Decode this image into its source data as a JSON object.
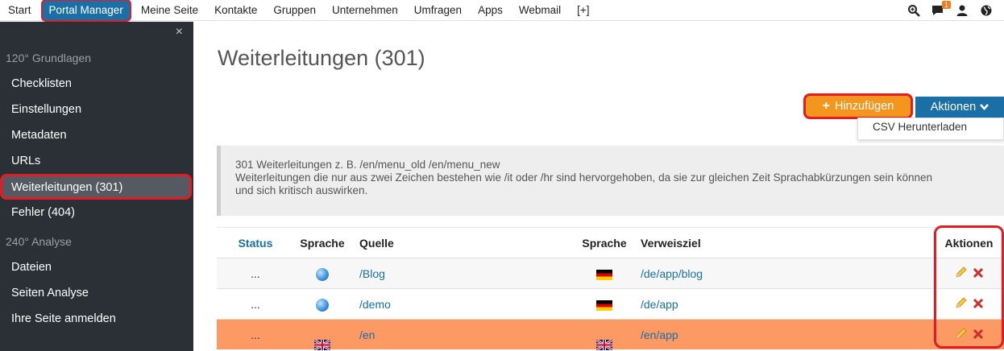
{
  "nav": {
    "items": [
      "Start",
      "Portal Manager",
      "Meine Seite",
      "Kontakte",
      "Gruppen",
      "Unternehmen",
      "Umfragen",
      "Apps",
      "Webmail",
      "[+]"
    ],
    "notification_count": "1"
  },
  "sidebar": {
    "close": "×",
    "section1": "120° Grundlagen",
    "items1": [
      "Checklisten",
      "Einstellungen",
      "Metadaten",
      "URLs",
      "Weiterleitungen (301)",
      "Fehler (404)"
    ],
    "section2": "240° Analyse",
    "items2": [
      "Dateien",
      "Seiten Analyse",
      "Ihre Seite anmelden"
    ]
  },
  "main": {
    "title": "Weiterleitungen (301)",
    "add_button": "Hinzufügen",
    "actions_button": "Aktionen",
    "dropdown_item": "CSV Herunterladen",
    "info_line1": "301 Weiterleitungen z. B. /en/menu_old /en/menu_new",
    "info_line2": "Weiterleitungen die nur aus zwei Zeichen bestehen wie /it oder /hr sind hervorgehoben, da sie zur gleichen Zeit Sprachabkürzungen sein können",
    "info_line3": "und sich kritisch auswirken."
  },
  "table": {
    "headers": {
      "status": "Status",
      "lang1": "Sprache",
      "source": "Quelle",
      "lang2": "Sprache",
      "target": "Verweisziel",
      "actions": "Aktionen"
    },
    "rows": [
      {
        "status": "...",
        "lang1": "globe",
        "source": "/Blog",
        "lang2": "de",
        "target": "/de/app/blog"
      },
      {
        "status": "...",
        "lang1": "globe",
        "source": "/demo",
        "lang2": "de",
        "target": "/de/app"
      },
      {
        "status": "...",
        "lang1": "uk",
        "source": "/en",
        "lang2": "uk",
        "target": "/en/app"
      }
    ]
  },
  "colors": {
    "accent": "#1a6fa6",
    "add": "#f2961e",
    "highlight": "#fd9a63",
    "sidebar": "#2b2f36",
    "outline": "#e31b23"
  }
}
